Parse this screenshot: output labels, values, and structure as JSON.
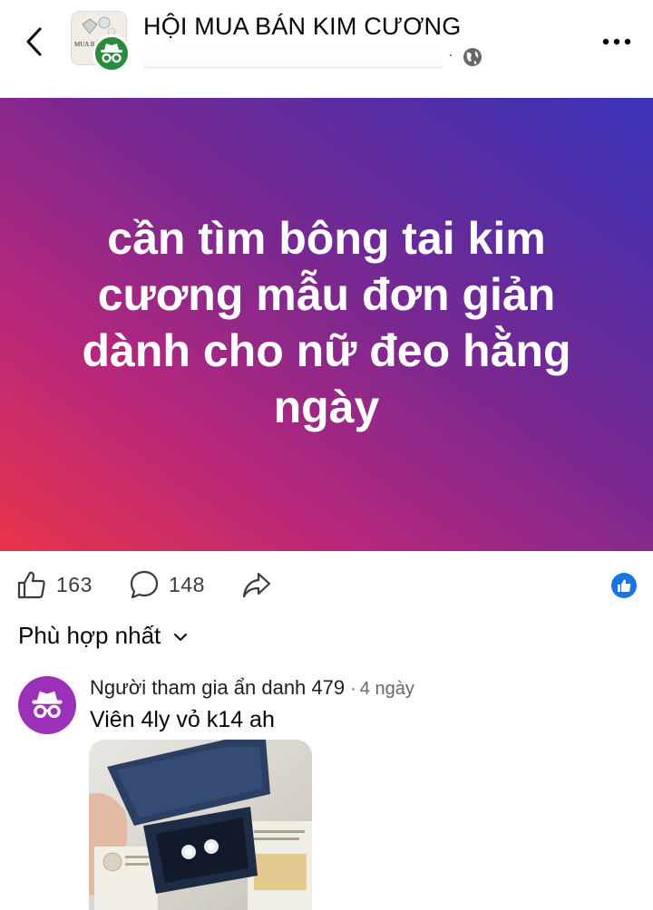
{
  "header": {
    "group_name": "HỘI MUA BÁN KIM CƯƠNG",
    "group_avatar_text": "MUA BÁ",
    "meta_dot": "·",
    "icons": {
      "back": "chevron-left-icon",
      "more": "more-horizontal-icon",
      "privacy": "globe-icon",
      "anonymous": "incognito-icon"
    }
  },
  "post": {
    "text": "cần tìm bông tai kim cương mẫu đơn giản dành cho nữ đeo hằng ngày",
    "gradient": [
      "#e8344a",
      "#b6277c",
      "#7b2890",
      "#3a33b8"
    ]
  },
  "actions": {
    "like_count": "163",
    "comment_count": "148",
    "icons": {
      "like": "thumbs-up-icon",
      "comment": "comment-bubble-icon",
      "share": "share-arrow-icon",
      "reaction": "like-reaction-icon"
    },
    "reaction_color": "#1b74e4"
  },
  "sort": {
    "label": "Phù hợp nhất",
    "icon": "chevron-down-icon"
  },
  "comment": {
    "author": "Người tham gia ẩn danh 479",
    "separator": "·",
    "time": "4 ngày",
    "text": "Viên 4ly vỏ k14 ah",
    "avatar_color": "#9b31b9",
    "avatar_icon": "incognito-icon",
    "photo_icon": "earring-box-photo"
  }
}
